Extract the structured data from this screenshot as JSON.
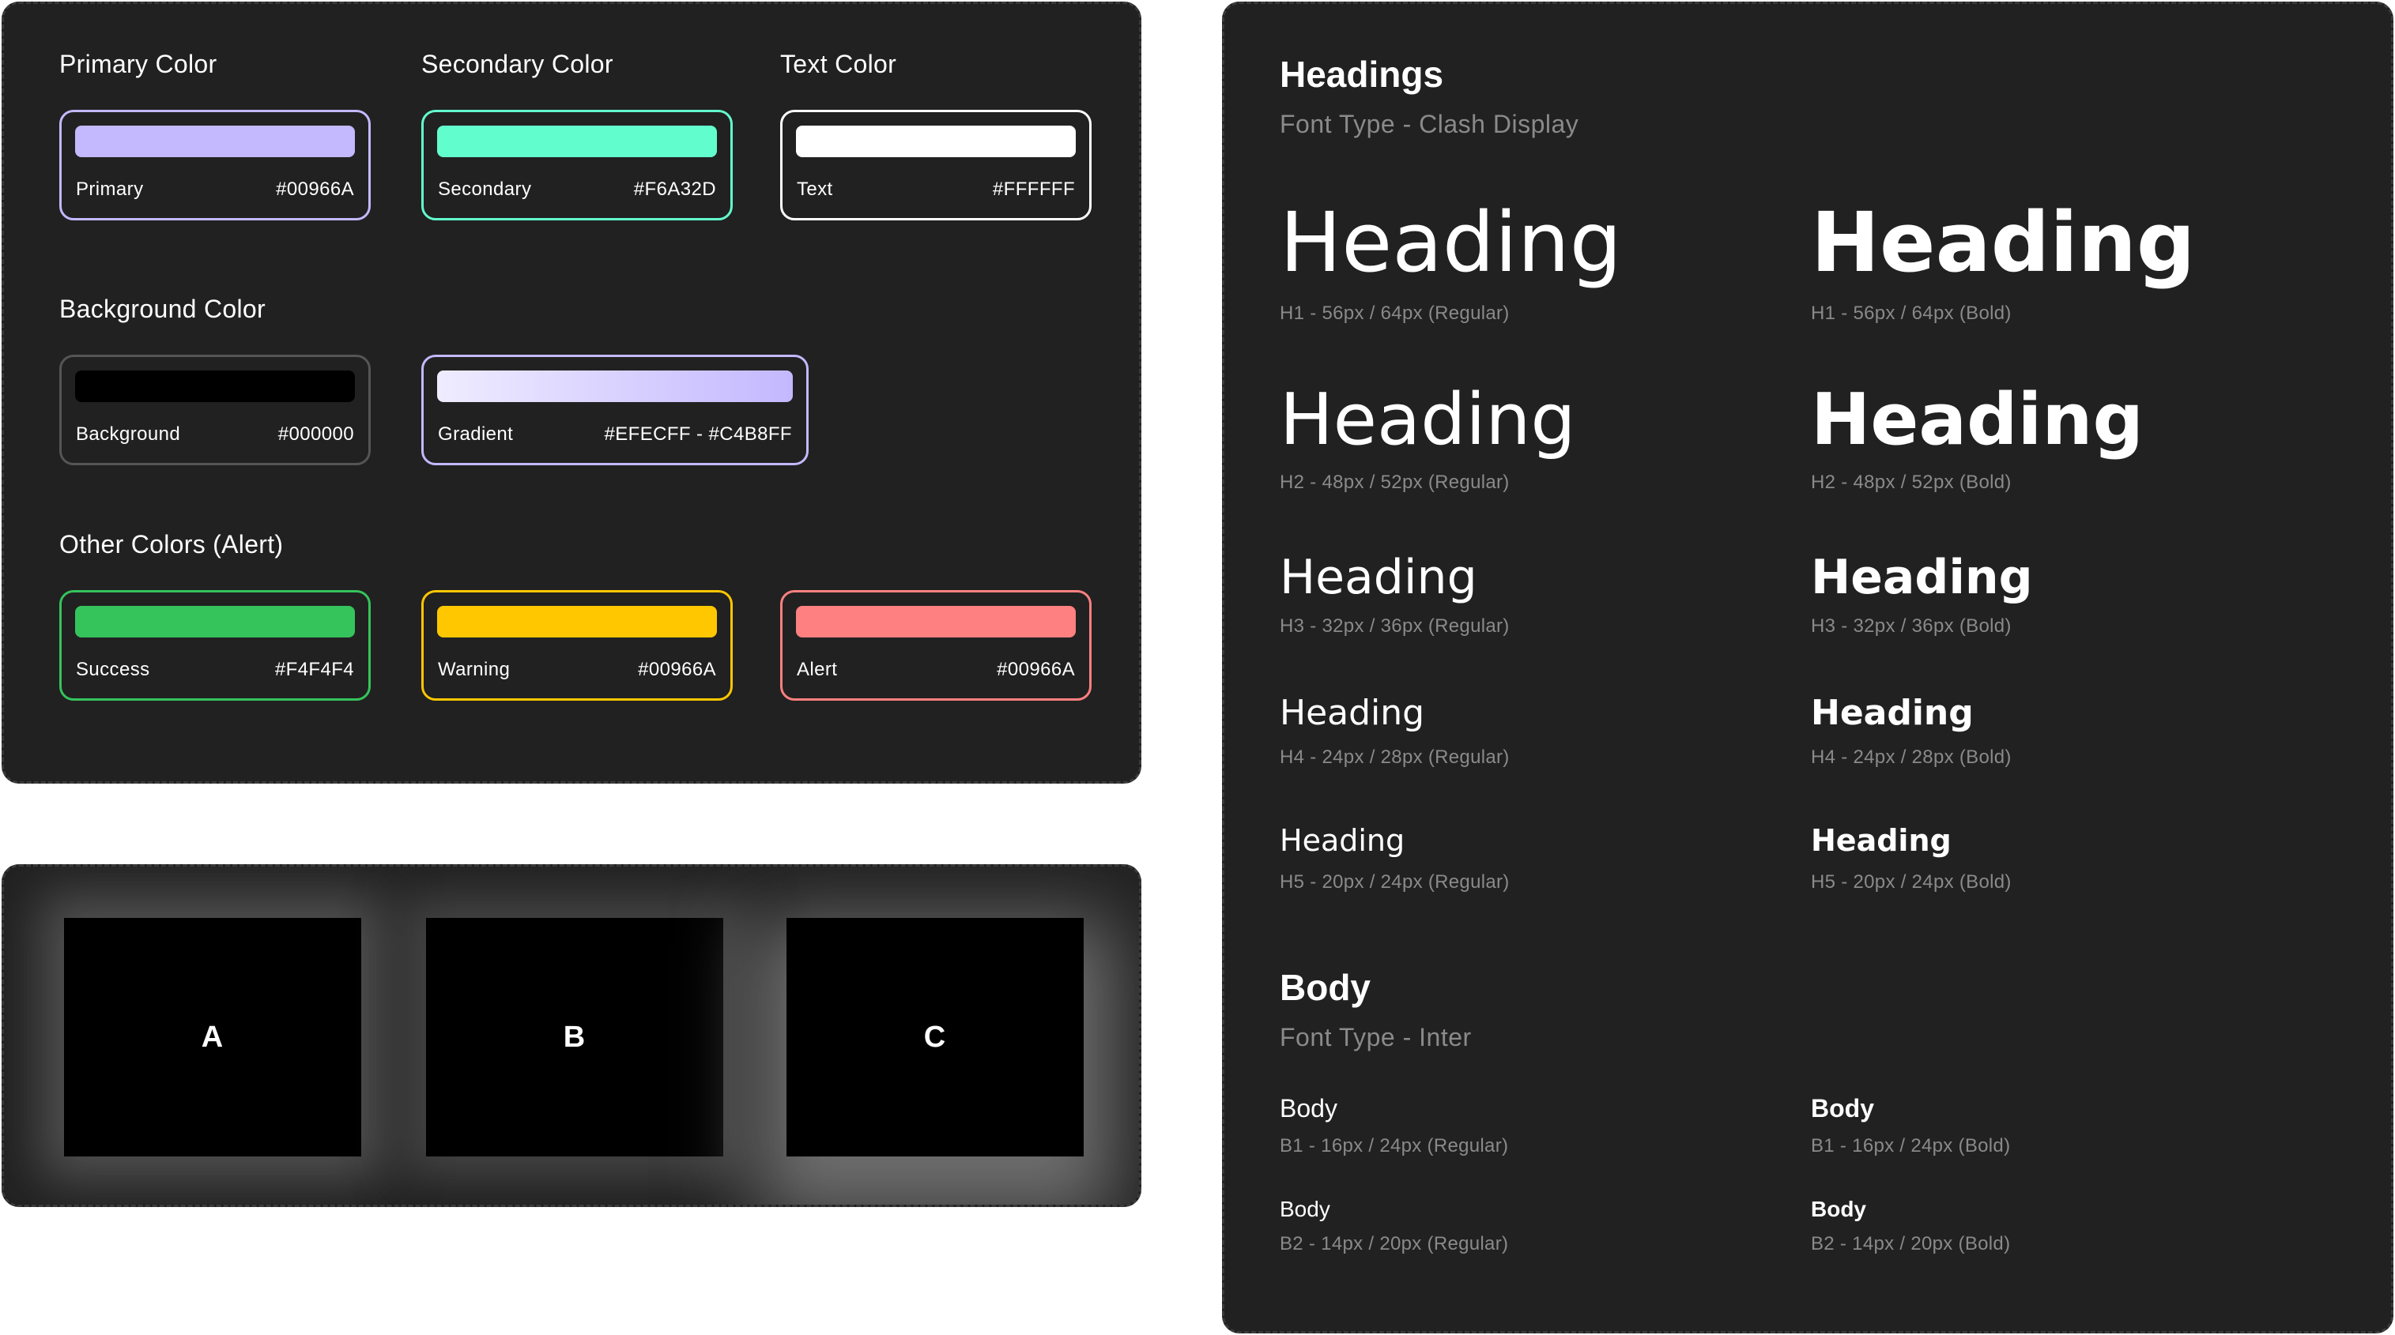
{
  "colors": {
    "primary_title": "Primary Color",
    "secondary_title": "Secondary Color",
    "text_title": "Text Color",
    "background_title": "Background Color",
    "other_title": "Other Colors (Alert)",
    "swatches": {
      "primary": {
        "name": "Primary",
        "hex": "#00966A",
        "fill": "#C4B8FF",
        "border": "#C4B8FF"
      },
      "secondary": {
        "name": "Secondary",
        "hex": "#F6A32D",
        "fill": "#62FDCD",
        "border": "#62FDCD"
      },
      "text": {
        "name": "Text",
        "hex": "#FFFFFF",
        "fill": "#FFFFFF",
        "border": "#FFFFFF"
      },
      "background": {
        "name": "Background",
        "hex": "#000000",
        "fill": "#000000",
        "border": "#000000"
      },
      "gradient": {
        "name": "Gradient",
        "hex": "#EFECFF  -  #C4B8FF",
        "from": "#EFECFF",
        "to": "#C4B8FF",
        "border": "#C4B8FF"
      },
      "success": {
        "name": "Success",
        "hex": "#F4F4F4",
        "fill": "#35C45C",
        "border": "#35C45C"
      },
      "warning": {
        "name": "Warning",
        "hex": "#00966A",
        "fill": "#FFC700",
        "border": "#FFC700"
      },
      "alert": {
        "name": "Alert",
        "hex": "#00966A",
        "fill": "#FF8080",
        "border": "#FF8080"
      }
    }
  },
  "shadows": {
    "cards": [
      {
        "label": "A"
      },
      {
        "label": "B"
      },
      {
        "label": "C"
      }
    ]
  },
  "typography": {
    "headings_title": "Headings",
    "headings_font": "Font Type - Clash Display",
    "headings": [
      {
        "text": "Heading",
        "regular": "H1 - 56px / 64px (Regular)",
        "bold": "H1 - 56px / 64px (Bold)"
      },
      {
        "text": "Heading",
        "regular": "H2 - 48px / 52px (Regular)",
        "bold": "H2 - 48px / 52px (Bold)"
      },
      {
        "text": "Heading",
        "regular": "H3 - 32px / 36px (Regular)",
        "bold": "H3 - 32px / 36px (Bold)"
      },
      {
        "text": "Heading",
        "regular": "H4 - 24px / 28px (Regular)",
        "bold": "H4 - 24px / 28px (Bold)"
      },
      {
        "text": "Heading",
        "regular": "H5 - 20px / 24px (Regular)",
        "bold": "H5 - 20px / 24px (Bold)"
      }
    ],
    "body_title": "Body",
    "body_font": "Font Type - Inter",
    "body": [
      {
        "text": "Body",
        "regular": "B1 - 16px / 24px (Regular)",
        "bold": "B1 - 16px / 24px (Bold)"
      },
      {
        "text": "Body",
        "regular": "B2 - 14px / 20px (Regular)",
        "bold": "B2 - 14px / 20px (Bold)"
      }
    ]
  }
}
